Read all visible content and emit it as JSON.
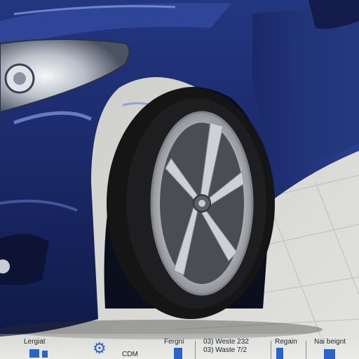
{
  "image": {
    "subject": "blue-car-front-wheel",
    "colors": {
      "paint": "#1c2c6e",
      "paint_highlight": "#6d86d6",
      "tire": "#151516",
      "rim": "#c6c9cd",
      "floor": "#cfd0cc"
    }
  },
  "bottom_strip": {
    "items": [
      {
        "label": "Lergiat",
        "icon": "blue-square-icon"
      },
      {
        "label": "CDM",
        "icon": "gear-icon"
      },
      {
        "label": "Fergni",
        "icon": "blue-bar-icon"
      },
      {
        "label": "03) Weste 232",
        "label2": "03) Waste 7/2"
      },
      {
        "label": "Regain",
        "icon": "blue-bar-icon"
      },
      {
        "label": "Nai beignt",
        "icon": "blue-square-icon"
      }
    ]
  }
}
